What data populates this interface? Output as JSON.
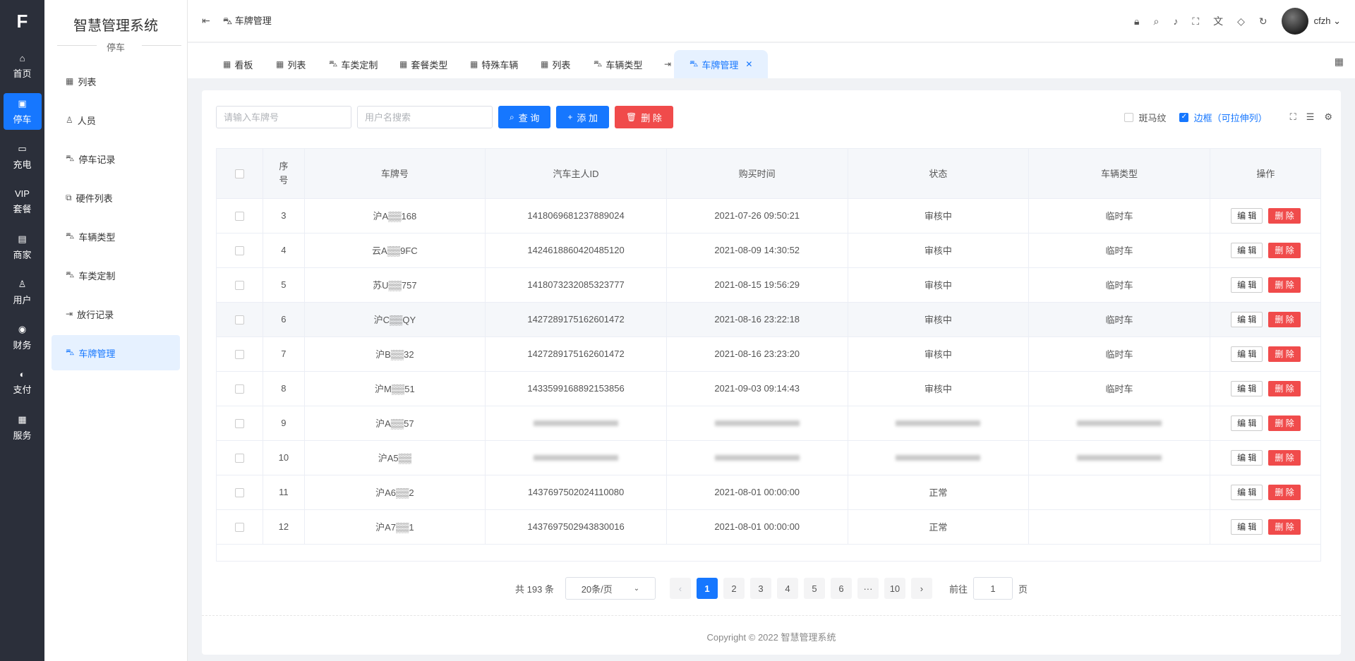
{
  "rail": {
    "logo": "F",
    "items": [
      {
        "label": "首页",
        "icon": "home-icon",
        "glyph": "⌂"
      },
      {
        "label": "停车",
        "icon": "parking-icon",
        "glyph": "▣",
        "active": true
      },
      {
        "label": "充电",
        "icon": "charging-icon",
        "glyph": "▭"
      },
      {
        "label": "套餐",
        "icon": "vip-icon",
        "glyph": "VIP"
      },
      {
        "label": "商家",
        "icon": "shop-icon",
        "glyph": "▤"
      },
      {
        "label": "用户",
        "icon": "user-icon",
        "glyph": "♙"
      },
      {
        "label": "财务",
        "icon": "finance-icon",
        "glyph": "◉"
      },
      {
        "label": "支付",
        "icon": "pay-icon",
        "glyph": "◐"
      },
      {
        "label": "服务",
        "icon": "service-icon",
        "glyph": "▦"
      }
    ]
  },
  "sidebar": {
    "title": "智慧管理系统",
    "subtitle": "停车",
    "items": [
      {
        "label": "列表",
        "icon": "grid-icon",
        "glyph": "▦"
      },
      {
        "label": "人员",
        "icon": "person-icon",
        "glyph": "♙"
      },
      {
        "label": "停车记录",
        "icon": "car-icon",
        "glyph": "⛍"
      },
      {
        "label": "硬件列表",
        "icon": "hardware-icon",
        "glyph": "⧉"
      },
      {
        "label": "车辆类型",
        "icon": "car-icon",
        "glyph": "⛍"
      },
      {
        "label": "车类定制",
        "icon": "car-icon",
        "glyph": "⛍"
      },
      {
        "label": "放行记录",
        "icon": "exit-icon",
        "glyph": "⇥"
      },
      {
        "label": "车牌管理",
        "icon": "car-icon",
        "glyph": "⛍",
        "active": true
      }
    ]
  },
  "header": {
    "fold_icon": "menu-fold-icon",
    "breadcrumb": "车牌管理",
    "tools": [
      "lock-icon",
      "search-icon",
      "bell-icon",
      "fullscreen-icon",
      "translate-icon",
      "theme-icon",
      "refresh-icon"
    ],
    "username": "cfzh"
  },
  "tabs": [
    {
      "label": "看板",
      "icon": "grid-icon",
      "glyph": "▦"
    },
    {
      "label": "列表",
      "icon": "grid-icon",
      "glyph": "▦"
    },
    {
      "label": "车类定制",
      "icon": "car-icon",
      "glyph": "⛍"
    },
    {
      "label": "套餐类型",
      "icon": "grid-icon",
      "glyph": "▦"
    },
    {
      "label": "特殊车辆",
      "icon": "grid-icon",
      "glyph": "▦"
    },
    {
      "label": "列表",
      "icon": "grid-icon",
      "glyph": "▦"
    },
    {
      "label": "车辆类型",
      "icon": "car-icon",
      "glyph": "⛍"
    },
    {
      "label": "放行记录",
      "icon": "exit-icon",
      "glyph": "⇥"
    },
    {
      "label": "车牌管理",
      "icon": "car-icon",
      "glyph": "⛍",
      "active": true
    }
  ],
  "toolbar": {
    "plate_placeholder": "请输入车牌号",
    "user_placeholder": "用户名搜索",
    "query_label": "查 询",
    "add_label": "添 加",
    "delete_label": "删 除",
    "stripe_label": "斑马纹",
    "border_label": "边框（可拉伸列）"
  },
  "table": {
    "columns": [
      "序号",
      "车牌号",
      "汽车主人ID",
      "购买时间",
      "状态",
      "车辆类型",
      "操作"
    ],
    "edit_label": "编 辑",
    "delete_label": "删 除",
    "rows": [
      {
        "no": "3",
        "plate": "沪A▒▒168",
        "owner": "1418069681237889024",
        "time": "2021-07-26 09:50:21",
        "status": "审核中",
        "type": "临时车"
      },
      {
        "no": "4",
        "plate": "云A▒▒9FC",
        "owner": "1424618860420485120",
        "time": "2021-08-09 14:30:52",
        "status": "审核中",
        "type": "临时车"
      },
      {
        "no": "5",
        "plate": "苏U▒▒757",
        "owner": "1418073232085323777",
        "time": "2021-08-15 19:56:29",
        "status": "审核中",
        "type": "临时车"
      },
      {
        "no": "6",
        "plate": "沪C▒▒QY",
        "owner": "1427289175162601472",
        "time": "2021-08-16 23:22:18",
        "status": "审核中",
        "type": "临时车",
        "highlight": true
      },
      {
        "no": "7",
        "plate": "沪B▒▒32",
        "owner": "1427289175162601472",
        "time": "2021-08-16 23:23:20",
        "status": "审核中",
        "type": "临时车"
      },
      {
        "no": "8",
        "plate": "沪M▒▒51",
        "owner": "1433599168892153856",
        "time": "2021-09-03 09:14:43",
        "status": "审核中",
        "type": "临时车"
      },
      {
        "no": "9",
        "plate": "沪A▒▒57",
        "owner": "",
        "time": "",
        "status": "",
        "type": "",
        "blurred": true
      },
      {
        "no": "10",
        "plate": "沪A5▒▒",
        "owner": "",
        "time": "",
        "status": "",
        "type": "",
        "blurred": true
      },
      {
        "no": "11",
        "plate": "沪A6▒▒2",
        "owner": "1437697502024110080",
        "time": "2021-08-01 00:00:00",
        "status": "正常",
        "type": ""
      },
      {
        "no": "12",
        "plate": "沪A7▒▒1",
        "owner": "1437697502943830016",
        "time": "2021-08-01 00:00:00",
        "status": "正常",
        "type": ""
      }
    ]
  },
  "pagination": {
    "total": "共 193 条",
    "page_size": "20条/页",
    "pages": [
      "1",
      "2",
      "3",
      "4",
      "5",
      "6",
      "···",
      "10"
    ],
    "current": "1",
    "goto_label": "前往",
    "goto_value": "1",
    "page_suffix": "页"
  },
  "footer": "Copyright © 2022 智慧管理系统",
  "colors": {
    "accent": "#1677ff",
    "danger": "#f04b4b",
    "rail": "#2b2f3a"
  }
}
